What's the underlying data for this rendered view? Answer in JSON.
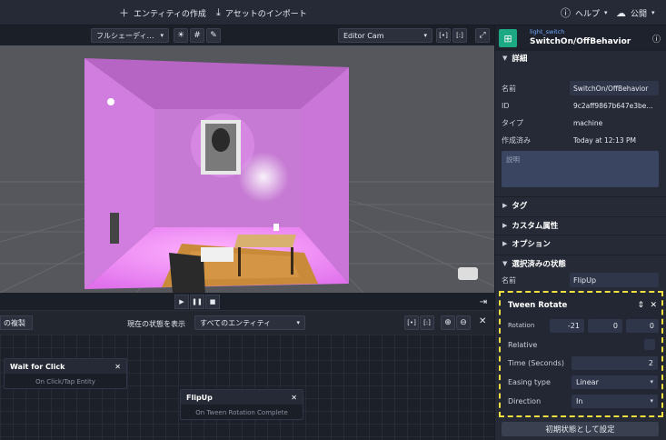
{
  "topbar": {
    "create_entity": "エンティティの作成",
    "import_asset": "アセットのインポート",
    "help": "ヘルプ",
    "publish": "公開"
  },
  "viewport": {
    "shading": "フルシェーディ…",
    "camera": "Editor Cam"
  },
  "behavior_editor": {
    "duplicate": "の複製",
    "show_state_label": "現在の状態を表示",
    "entity_filter": "すべてのエンティティ",
    "nodes": [
      {
        "title": "Wait for Click",
        "subtitle": "On Click/Tap Entity"
      },
      {
        "title": "FlipUp",
        "subtitle": "On Tween Rotation Complete"
      }
    ]
  },
  "panel": {
    "header_sub": "light_switch",
    "header_title": "SwitchOn/OffBehavior",
    "details_title": "詳細",
    "name_label": "名前",
    "name_value": "SwitchOn/OffBehavior",
    "id_label": "ID",
    "id_value": "9c2aff9867b647e3be…",
    "type_label": "タイプ",
    "type_value": "machine",
    "created_label": "作成済み",
    "created_value": "Today at 12:13 PM",
    "description_placeholder": "説明",
    "tags_title": "タグ",
    "custom_attr_title": "カスタム属性",
    "options_title": "オプション",
    "selected_state_title": "選択済みの状態",
    "state_name_label": "名前",
    "state_name_value": "FlipUp",
    "set_initial_button": "初期状態として設定"
  },
  "tween": {
    "title": "Tween Rotate",
    "rotation_label": "Rotation",
    "rotation_x": "-21",
    "rotation_y": "0",
    "rotation_z": "0",
    "relative_label": "Relative",
    "time_label": "Time (Seconds)",
    "time_value": "2",
    "easing_label": "Easing type",
    "easing_value": "Linear",
    "direction_label": "Direction",
    "direction_value": "In"
  },
  "colors": {
    "room_wall": "#c878d6",
    "room_side": "#d27fe0",
    "floor_glow": "#f08cf5",
    "accent_yellow": "#f0e040",
    "header_logo": "#1ca882"
  }
}
